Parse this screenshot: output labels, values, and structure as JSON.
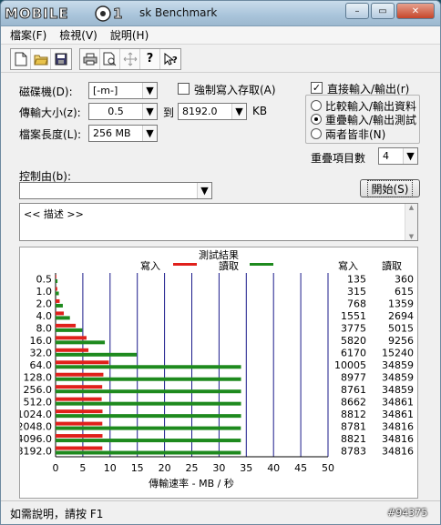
{
  "window": {
    "title_text": "sk Benchmark",
    "logo_text": "MOBILE01"
  },
  "menu": [
    "檔案(F)",
    "檢視(V)",
    "說明(H)"
  ],
  "toolbar_icons": [
    "new-file-icon",
    "open-folder-icon",
    "save-icon",
    "print-icon",
    "print-preview-icon",
    "move-icon",
    "help-icon",
    "context-help-icon"
  ],
  "settings": {
    "drive_label": "磁碟機(D):",
    "drive_value": "[-m-]",
    "transfer_label": "傳輸大小(z):",
    "transfer_from": "0.5",
    "to_label": "到",
    "transfer_to": "8192.0",
    "unit": "KB",
    "file_length_label": "檔案長度(L):",
    "file_length_value": "256 MB",
    "force_write_label": "強制寫入存取(A)",
    "force_write_checked": false,
    "direct_io_label": "直接輸入/輸出(r)",
    "direct_io_checked": true,
    "radio_options": [
      "比較輸入/輸出資料",
      "重疊輸入/輸出測試",
      "兩者皆非(N)"
    ],
    "radio_selected": 1,
    "queue_label": "重疊項目數",
    "queue_value": "4",
    "controlled_by_label": "控制由(b):",
    "controlled_by_value": "",
    "start_button": "開始(S)",
    "description_text": "<<     描述     >>"
  },
  "results": {
    "title": "測試結果",
    "legend_write": "寫入",
    "legend_read": "讀取",
    "col_write": "寫入",
    "col_read": "讀取",
    "write_color": "#e0201b",
    "read_color": "#1e8a1e"
  },
  "chart_data": {
    "type": "bar",
    "orientation": "horizontal",
    "title": "測試結果",
    "xlabel": "傳輸速率 - MB / 秒",
    "xlim": [
      0,
      50
    ],
    "xticks": [
      0,
      5,
      10,
      15,
      20,
      25,
      30,
      35,
      40,
      45,
      50
    ],
    "categories": [
      "0.5",
      "1.0",
      "2.0",
      "4.0",
      "8.0",
      "16.0",
      "32.0",
      "64.0",
      "128.0",
      "256.0",
      "512.0",
      "1024.0",
      "2048.0",
      "4096.0",
      "8192.0"
    ],
    "series": [
      {
        "name": "寫入",
        "values": [
          0.13,
          0.31,
          0.75,
          1.51,
          3.69,
          5.68,
          6.03,
          9.77,
          8.77,
          8.56,
          8.46,
          8.61,
          8.58,
          8.61,
          8.58
        ]
      },
      {
        "name": "讀取",
        "values": [
          0.35,
          0.6,
          1.33,
          2.63,
          4.9,
          9.04,
          14.88,
          34.04,
          34.04,
          34.04,
          34.04,
          34.04,
          34.0,
          34.0,
          34.0
        ]
      }
    ],
    "table": {
      "write": [
        "135",
        "315",
        "768",
        "1551",
        "3775",
        "5820",
        "6170",
        "10005",
        "8977",
        "8761",
        "8662",
        "8812",
        "8781",
        "8821",
        "8783"
      ],
      "read": [
        "360",
        "615",
        "1359",
        "2694",
        "5015",
        "9256",
        "15240",
        "34859",
        "34859",
        "34859",
        "34861",
        "34861",
        "34816",
        "34816",
        "34816"
      ]
    },
    "grid": true
  },
  "status": {
    "help_text": "如需說明，請按 F1",
    "watermark": "#94375"
  }
}
